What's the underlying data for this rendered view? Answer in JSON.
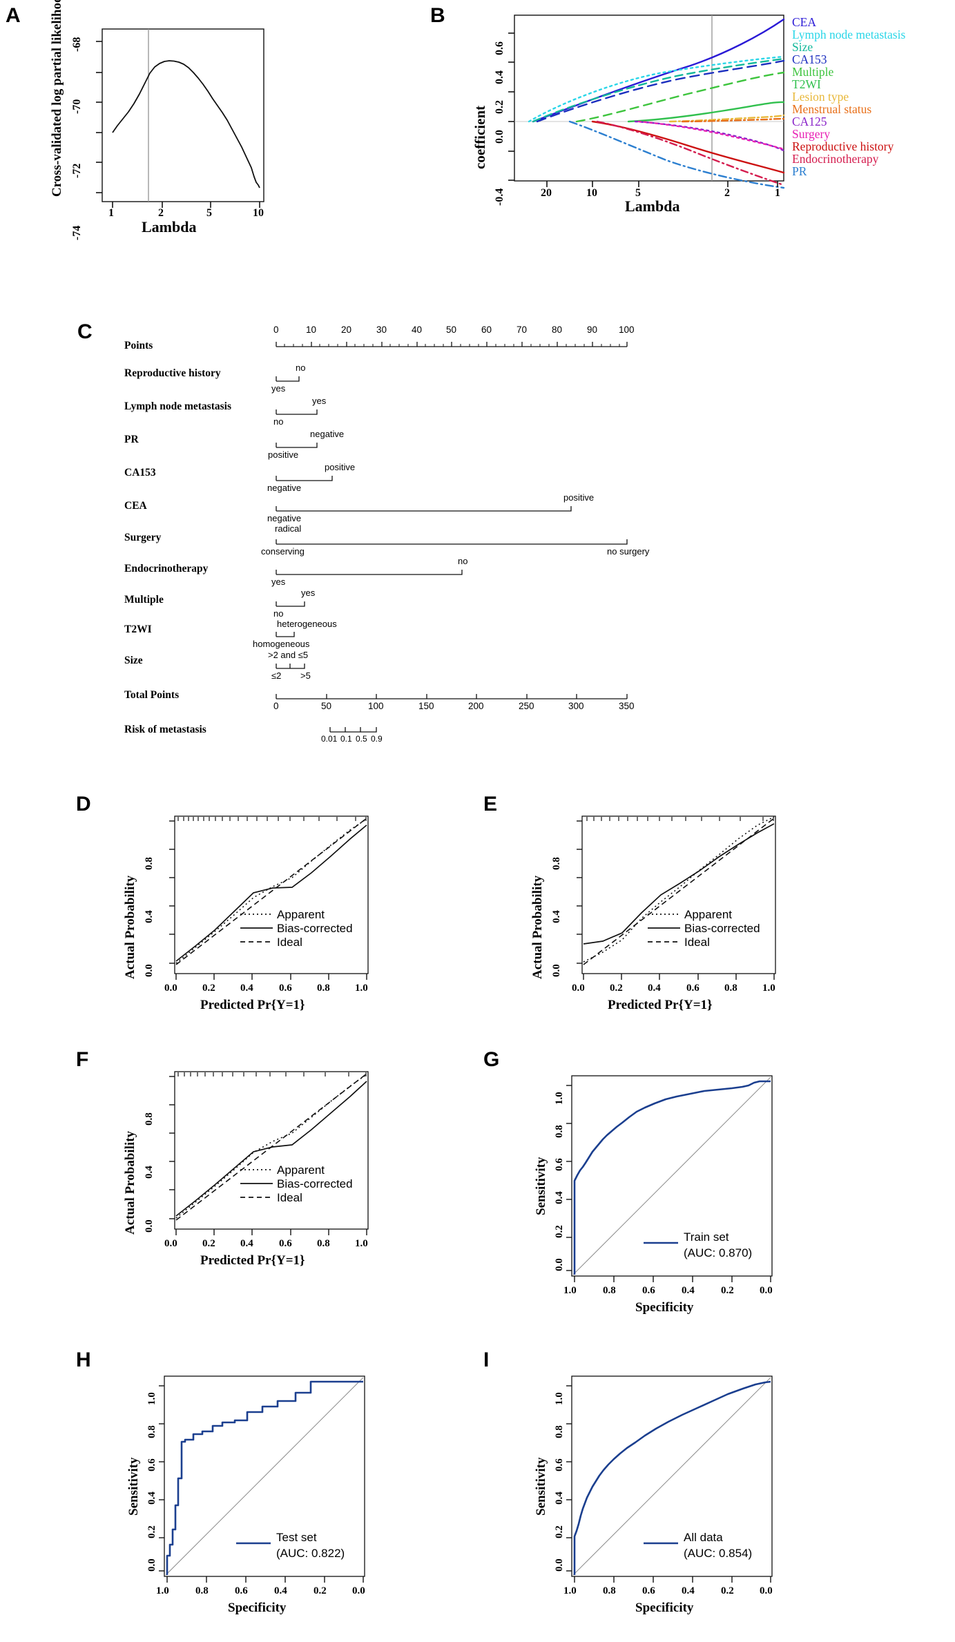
{
  "panels": {
    "A": {
      "letter": "A",
      "ylabel": "Cross-validated log partial likelihood",
      "xlabel": "Lambda",
      "yticks": [
        "-68",
        "-70",
        "-72",
        "-74"
      ],
      "xticks": [
        "1",
        "2",
        "5",
        "10"
      ]
    },
    "B": {
      "letter": "B",
      "ylabel": "coefficient",
      "xlabel": "Lambda",
      "yticks": [
        "0.6",
        "0.4",
        "0.2",
        "0.0",
        "-0.4"
      ],
      "xticks": [
        "20",
        "10",
        "5",
        "2",
        "1"
      ],
      "legend": [
        {
          "label": "CEA",
          "color": "#2a1ad6",
          "dash": "solid"
        },
        {
          "label": "Lymph  node metastasis",
          "color": "#2ad6e8",
          "dash": "dotted"
        },
        {
          "label": "Size",
          "color": "#13b89a",
          "dash": "dashed"
        },
        {
          "label": "CA153",
          "color": "#1c2fbf",
          "dash": "dashed"
        },
        {
          "label": "Multiple",
          "color": "#3ec43e",
          "dash": "dashed"
        },
        {
          "label": "T2WI",
          "color": "#31c04e",
          "dash": "solid"
        },
        {
          "label": "Lesion type",
          "color": "#e8b83a",
          "dash": "dashdot"
        },
        {
          "label": "Menstrual status",
          "color": "#e8701a",
          "dash": "dashdot"
        },
        {
          "label": "CA125",
          "color": "#8a24c9",
          "dash": "dotted"
        },
        {
          "label": "Surgery",
          "color": "#e81fb4",
          "dash": "dotted"
        },
        {
          "label": "Reproductive history",
          "color": "#cc1111",
          "dash": "solid"
        },
        {
          "label": "Endocrinotherapy",
          "color": "#d41c4e",
          "dash": "dashdot"
        },
        {
          "label": "PR",
          "color": "#2c7fd0",
          "dash": "dashdot"
        }
      ]
    }
  },
  "nomogram": {
    "letter": "C",
    "rows": [
      {
        "name": "Points",
        "type": "axis",
        "ticks": [
          "0",
          "10",
          "20",
          "30",
          "40",
          "50",
          "60",
          "70",
          "80",
          "90",
          "100"
        ]
      },
      {
        "name": "Reproductive history",
        "type": "scale",
        "left": "yes",
        "right": "no",
        "left_pos": 0,
        "right_pos": 6.5
      },
      {
        "name": "Lymph node metastasis",
        "type": "scale",
        "left": "no",
        "right": "yes",
        "left_pos": 0,
        "right_pos": 11.5
      },
      {
        "name": "PR",
        "type": "scale",
        "left": "positive",
        "right": "negative",
        "left_pos": 0,
        "right_pos": 11.5
      },
      {
        "name": "CA153",
        "type": "scale",
        "left": "negative",
        "right": "positive",
        "left_pos": 0,
        "right_pos": 16
      },
      {
        "name": "CEA",
        "type": "scale",
        "left": "negative",
        "right": "positive",
        "left_pos": 0,
        "right_pos": 84
      },
      {
        "name": "Surgery",
        "type": "scale3",
        "left": "conserving",
        "mid": "radical",
        "right": "no surgery",
        "left_pos": 0,
        "mid_pos": 0,
        "right_pos": 100
      },
      {
        "name": "Endocrinotherapy",
        "type": "scale",
        "left": "yes",
        "right": "no",
        "left_pos": 0,
        "right_pos": 53
      },
      {
        "name": "Multiple",
        "type": "scale",
        "left": "no",
        "right": "yes",
        "left_pos": 0,
        "right_pos": 8
      },
      {
        "name": "T2WI",
        "type": "scale",
        "left": "homogeneous",
        "right": "heterogeneous",
        "left_pos": 0,
        "right_pos": 5
      },
      {
        "name": "Size",
        "type": "scale3",
        "left": "≤2",
        "mid": ">2 and ≤5",
        "right": ">5",
        "left_pos": 0,
        "mid_pos": 4,
        "right_pos": 8
      },
      {
        "name": "Total Points",
        "type": "axis2",
        "ticks": [
          "0",
          "50",
          "100",
          "150",
          "200",
          "250",
          "300",
          "350"
        ]
      },
      {
        "name": "Risk of metastasis",
        "type": "risk",
        "ticks": [
          "0.01",
          "0.1",
          "0.5",
          "0.9"
        ]
      }
    ]
  },
  "calibration": [
    {
      "letter": "D",
      "ylabel": "Actual Probability",
      "xlabel": "Predicted Pr{Y=1}",
      "yticks": [
        "0.0",
        "0.4",
        "0.8"
      ],
      "xticks": [
        "0.0",
        "0.2",
        "0.4",
        "0.6",
        "0.8",
        "1.0"
      ],
      "legend": [
        "Apparent",
        "Bias-corrected",
        "Ideal"
      ]
    },
    {
      "letter": "E",
      "ylabel": "Actual Probability",
      "xlabel": "Predicted Pr{Y=1}",
      "yticks": [
        "0.0",
        "0.4",
        "0.8"
      ],
      "xticks": [
        "0.0",
        "0.2",
        "0.4",
        "0.6",
        "0.8",
        "1.0"
      ],
      "legend": [
        "Apparent",
        "Bias-corrected",
        "Ideal"
      ]
    },
    {
      "letter": "F",
      "ylabel": "Actual Probability",
      "xlabel": "Predicted Pr{Y=1}",
      "yticks": [
        "0.0",
        "0.4",
        "0.8"
      ],
      "xticks": [
        "0.0",
        "0.2",
        "0.4",
        "0.6",
        "0.8",
        "1.0"
      ],
      "legend": [
        "Apparent",
        "Bias-corrected",
        "Ideal"
      ]
    }
  ],
  "roc": [
    {
      "letter": "G",
      "ylabel": "Sensitivity",
      "xlabel": "Specificity",
      "yticks": [
        "0.0",
        "0.2",
        "0.4",
        "0.6",
        "0.8",
        "1.0"
      ],
      "xticks": [
        "1.0",
        "0.8",
        "0.6",
        "0.4",
        "0.2",
        "0.0"
      ],
      "legend_name": "Train set",
      "legend_auc": "(AUC: 0.870)",
      "color": "#1b3f8f"
    },
    {
      "letter": "H",
      "ylabel": "Sensitivity",
      "xlabel": "Specificity",
      "yticks": [
        "0.0",
        "0.2",
        "0.4",
        "0.6",
        "0.8",
        "1.0"
      ],
      "xticks": [
        "1.0",
        "0.8",
        "0.6",
        "0.4",
        "0.2",
        "0.0"
      ],
      "legend_name": "Test set",
      "legend_auc": "(AUC: 0.822)",
      "color": "#1b3f8f"
    },
    {
      "letter": "I",
      "ylabel": "Sensitivity",
      "xlabel": "Specificity",
      "yticks": [
        "0.0",
        "0.2",
        "0.4",
        "0.6",
        "0.8",
        "1.0"
      ],
      "xticks": [
        "1.0",
        "0.8",
        "0.6",
        "0.4",
        "0.2",
        "0.0"
      ],
      "legend_name": "All data",
      "legend_auc": "(AUC: 0.854)",
      "color": "#1b3f8f"
    }
  ],
  "chart_data": [
    {
      "type": "line",
      "panel": "A",
      "title": "",
      "xlabel": "Lambda",
      "ylabel": "Cross-validated log partial likelihood",
      "xscale": "log",
      "xlim": [
        1,
        10
      ],
      "ylim": [
        -74.6,
        -67.4
      ],
      "xticks": [
        1,
        2,
        5,
        10
      ],
      "yticks": [
        -68,
        -70,
        -72,
        -74
      ],
      "vline_x": 2.6,
      "x": [
        1.0,
        1.15,
        1.3,
        1.5,
        1.75,
        2.0,
        2.3,
        2.6,
        3.0,
        3.5,
        4.0,
        4.6,
        5.3,
        6.1,
        7.0,
        8.0,
        9.0,
        10.0
      ],
      "y": [
        -70.35,
        -69.9,
        -69.5,
        -69.1,
        -68.6,
        -68.25,
        -68.02,
        -67.92,
        -67.95,
        -68.1,
        -68.4,
        -68.8,
        -69.3,
        -70.0,
        -70.9,
        -72.0,
        -73.1,
        -74.4
      ]
    },
    {
      "type": "line",
      "panel": "B",
      "title": "",
      "xlabel": "Lambda",
      "ylabel": "coefficient",
      "xscale": "log-reverse",
      "xlim": [
        30,
        0.9
      ],
      "ylim": [
        -0.62,
        0.72
      ],
      "xticks": [
        20,
        10,
        5,
        2,
        1
      ],
      "yticks": [
        0.6,
        0.4,
        0.2,
        0.0,
        -0.4
      ],
      "vline_x": 2.4,
      "series": [
        {
          "name": "CEA",
          "final": 0.7,
          "start_lambda": 26
        },
        {
          "name": "Lymph  node metastasis",
          "final": 0.5,
          "start_lambda": 28
        },
        {
          "name": "Size",
          "final": 0.47,
          "start_lambda": 26
        },
        {
          "name": "CA153",
          "final": 0.45,
          "start_lambda": 24
        },
        {
          "name": "Multiple",
          "final": 0.33,
          "start_lambda": 14
        },
        {
          "name": "T2WI",
          "final": 0.13,
          "start_lambda": 6
        },
        {
          "name": "Lesion type",
          "final": 0.05,
          "start_lambda": 3
        },
        {
          "name": "Menstrual status",
          "final": 0.02,
          "start_lambda": 2.5
        },
        {
          "name": "CA125",
          "final": -0.22,
          "start_lambda": 5
        },
        {
          "name": "Surgery",
          "final": -0.21,
          "start_lambda": 4.6
        },
        {
          "name": "Reproductive history",
          "final": -0.36,
          "start_lambda": 9
        },
        {
          "name": "Endocrinotherapy",
          "final": -0.47,
          "start_lambda": 8
        },
        {
          "name": "PR",
          "final": -0.52,
          "start_lambda": 13
        }
      ]
    },
    {
      "type": "line",
      "panel": "D",
      "title": "",
      "xlabel": "Predicted Pr{Y=1}",
      "ylabel": "Actual Probability",
      "xlim": [
        0,
        1
      ],
      "ylim": [
        0,
        1
      ],
      "series": [
        {
          "name": "Ideal",
          "x": [
            0,
            1
          ],
          "y": [
            0,
            1
          ]
        },
        {
          "name": "Apparent",
          "x": [
            0.0,
            0.1,
            0.2,
            0.3,
            0.4,
            0.5,
            0.6,
            0.7,
            0.8,
            0.9,
            1.0
          ],
          "y": [
            0.01,
            0.1,
            0.2,
            0.31,
            0.4,
            0.49,
            0.6,
            0.71,
            0.81,
            0.9,
            0.99
          ]
        },
        {
          "name": "Bias-corrected",
          "x": [
            0.0,
            0.1,
            0.2,
            0.3,
            0.4,
            0.5,
            0.6,
            0.7,
            0.8,
            0.9,
            1.0
          ],
          "y": [
            0.02,
            0.11,
            0.21,
            0.33,
            0.38,
            0.45,
            0.56,
            0.66,
            0.76,
            0.85,
            0.93
          ]
        }
      ]
    },
    {
      "type": "line",
      "panel": "E",
      "title": "",
      "xlabel": "Predicted Pr{Y=1}",
      "ylabel": "Actual Probability",
      "xlim": [
        0,
        1
      ],
      "ylim": [
        0,
        1
      ],
      "series": [
        {
          "name": "Ideal",
          "x": [
            0,
            1
          ],
          "y": [
            0,
            1
          ]
        },
        {
          "name": "Apparent",
          "x": [
            0.0,
            0.1,
            0.2,
            0.3,
            0.4,
            0.5,
            0.6,
            0.7,
            0.8,
            0.9,
            1.0
          ],
          "y": [
            0.02,
            0.08,
            0.16,
            0.3,
            0.41,
            0.51,
            0.62,
            0.72,
            0.82,
            0.91,
            1.0
          ]
        },
        {
          "name": "Bias-corrected",
          "x": [
            0.0,
            0.1,
            0.2,
            0.3,
            0.4,
            0.5,
            0.6,
            0.7,
            0.8,
            0.9,
            1.0
          ],
          "y": [
            0.13,
            0.15,
            0.2,
            0.33,
            0.4,
            0.48,
            0.57,
            0.66,
            0.74,
            0.82,
            0.9
          ]
        }
      ]
    },
    {
      "type": "line",
      "panel": "F",
      "title": "",
      "xlabel": "Predicted Pr{Y=1}",
      "ylabel": "Actual Probability",
      "xlim": [
        0,
        1
      ],
      "ylim": [
        0,
        1
      ],
      "series": [
        {
          "name": "Ideal",
          "x": [
            0,
            1
          ],
          "y": [
            0,
            1
          ]
        },
        {
          "name": "Apparent",
          "x": [
            0.0,
            0.1,
            0.2,
            0.3,
            0.4,
            0.5,
            0.6,
            0.7,
            0.8,
            0.9,
            1.0
          ],
          "y": [
            0.02,
            0.1,
            0.19,
            0.3,
            0.41,
            0.5,
            0.61,
            0.71,
            0.81,
            0.9,
            0.99
          ]
        },
        {
          "name": "Bias-corrected",
          "x": [
            0.0,
            0.1,
            0.2,
            0.3,
            0.4,
            0.5,
            0.6,
            0.7,
            0.8,
            0.9,
            1.0
          ],
          "y": [
            0.03,
            0.11,
            0.2,
            0.31,
            0.36,
            0.44,
            0.55,
            0.65,
            0.75,
            0.84,
            0.92
          ]
        }
      ]
    },
    {
      "type": "line",
      "panel": "G",
      "title": "",
      "xlabel": "Specificity",
      "ylabel": "Sensitivity",
      "auc": 0.87,
      "legend": "Train set",
      "x": [
        1.0,
        1.0,
        0.99,
        0.98,
        0.97,
        0.96,
        0.95,
        0.93,
        0.91,
        0.89,
        0.87,
        0.85,
        0.82,
        0.78,
        0.74,
        0.7,
        0.65,
        0.58,
        0.52,
        0.45,
        0.3,
        0.12,
        0.08,
        0.0
      ],
      "y": [
        0.0,
        0.47,
        0.52,
        0.55,
        0.58,
        0.62,
        0.66,
        0.7,
        0.74,
        0.78,
        0.82,
        0.84,
        0.86,
        0.88,
        0.9,
        0.92,
        0.94,
        0.96,
        0.96,
        0.96,
        0.96,
        0.96,
        1.0,
        1.0
      ]
    },
    {
      "type": "line",
      "panel": "H",
      "title": "",
      "xlabel": "Specificity",
      "ylabel": "Sensitivity",
      "auc": 0.822,
      "legend": "Test set",
      "x": [
        1.0,
        1.0,
        0.99,
        0.98,
        0.97,
        0.96,
        0.95,
        0.93,
        0.9,
        0.86,
        0.82,
        0.78,
        0.72,
        0.66,
        0.6,
        0.52,
        0.45,
        0.35,
        0.25,
        0.15,
        0.0
      ],
      "y": [
        0.0,
        0.09,
        0.12,
        0.21,
        0.36,
        0.55,
        0.68,
        0.69,
        0.72,
        0.76,
        0.79,
        0.8,
        0.82,
        0.86,
        0.89,
        0.92,
        0.95,
        0.98,
        1.0,
        1.0,
        1.0
      ]
    },
    {
      "type": "line",
      "panel": "I",
      "title": "",
      "xlabel": "Specificity",
      "ylabel": "Sensitivity",
      "auc": 0.854,
      "legend": "All data",
      "x": [
        1.0,
        1.0,
        0.99,
        0.98,
        0.97,
        0.96,
        0.94,
        0.92,
        0.89,
        0.86,
        0.82,
        0.77,
        0.72,
        0.66,
        0.58,
        0.5,
        0.4,
        0.28,
        0.15,
        0.05,
        0.0
      ],
      "y": [
        0.0,
        0.2,
        0.27,
        0.37,
        0.44,
        0.5,
        0.57,
        0.64,
        0.7,
        0.76,
        0.81,
        0.85,
        0.88,
        0.91,
        0.93,
        0.95,
        0.97,
        0.98,
        0.99,
        1.0,
        1.0
      ]
    }
  ]
}
